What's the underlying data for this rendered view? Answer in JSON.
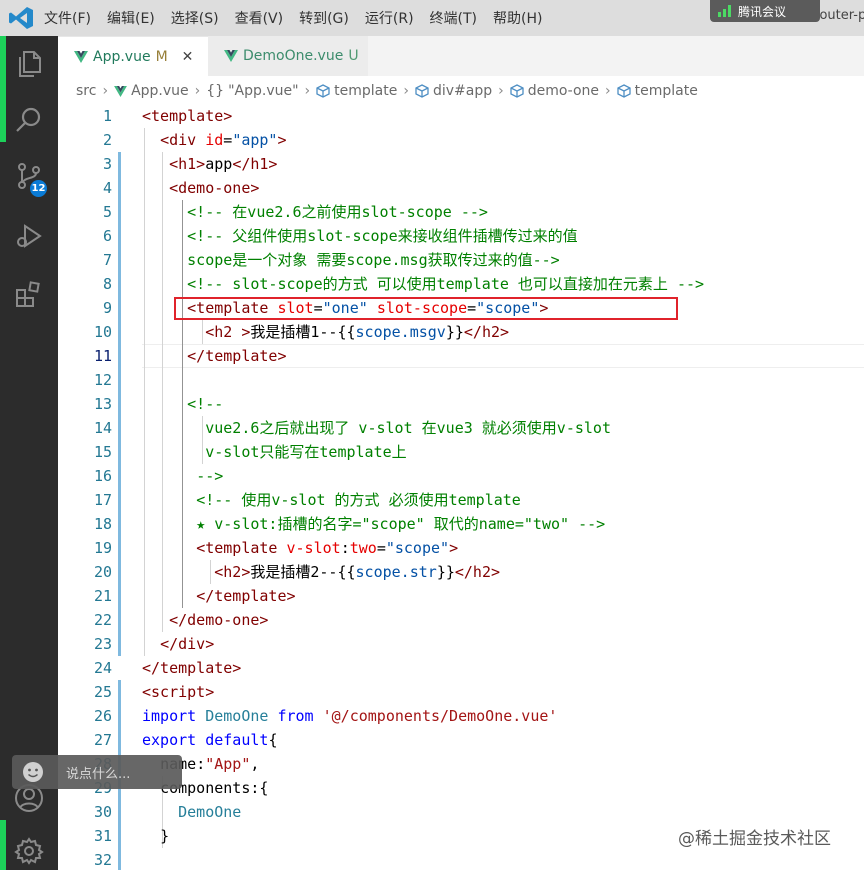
{
  "menu": [
    "文件(F)",
    "编辑(E)",
    "选择(S)",
    "查看(V)",
    "转到(G)",
    "运行(R)",
    "终端(T)",
    "帮助(H)"
  ],
  "window_title": "App.vue - router-p",
  "meeting_label": "腾讯会议",
  "colors": {
    "activity_bar": "#2c2c2c",
    "accent_green": "#1dd15a",
    "highlight_box": "#e0232b",
    "badge": "#0a7bd6"
  },
  "activity_bar": {
    "icons": [
      "explorer-icon",
      "search-icon",
      "source-control-icon",
      "run-debug-icon",
      "extensions-icon",
      "account-icon",
      "settings-gear-icon"
    ],
    "scm_badge": "12"
  },
  "tabs": [
    {
      "label": "App.vue",
      "status": "M",
      "active": true
    },
    {
      "label": "DemoOne.vue",
      "status": "U",
      "active": false
    }
  ],
  "tab_close": "✕",
  "breadcrumb": [
    "src",
    "App.vue",
    "\"App.vue\"",
    "template",
    "div#app",
    "demo-one",
    "template"
  ],
  "editor": {
    "active_line": "11",
    "lines": [
      {
        "n": "1",
        "tokens": [
          [
            "t",
            "<template>"
          ]
        ]
      },
      {
        "n": "2",
        "tokens": [
          [
            "p",
            "  "
          ],
          [
            "t",
            "<div"
          ],
          [
            "p",
            " "
          ],
          [
            "a",
            "id"
          ],
          [
            "p",
            "="
          ],
          [
            "s",
            "\"app\""
          ],
          [
            "t",
            ">"
          ]
        ]
      },
      {
        "n": "3",
        "tokens": [
          [
            "p",
            "   "
          ],
          [
            "t",
            "<h1>"
          ],
          [
            "p",
            "app"
          ],
          [
            "t",
            "</h1>"
          ]
        ]
      },
      {
        "n": "4",
        "tokens": [
          [
            "p",
            "   "
          ],
          [
            "t",
            "<demo-one>"
          ]
        ]
      },
      {
        "n": "5",
        "tokens": [
          [
            "p",
            "     "
          ],
          [
            "c",
            "<!-- 在vue2.6之前使用slot-scope -->"
          ]
        ]
      },
      {
        "n": "6",
        "tokens": [
          [
            "p",
            "     "
          ],
          [
            "c",
            "<!-- 父组件使用slot-scope来接收组件插槽传过来的值"
          ]
        ]
      },
      {
        "n": "7",
        "tokens": [
          [
            "p",
            "     "
          ],
          [
            "c",
            "scope是一个对象 需要scope.msg获取传过来的值-->"
          ]
        ]
      },
      {
        "n": "8",
        "tokens": [
          [
            "p",
            "     "
          ],
          [
            "c",
            "<!-- slot-scope的方式 可以使用template 也可以直接加在元素上 -->"
          ]
        ]
      },
      {
        "n": "9",
        "tokens": [
          [
            "p",
            "     "
          ],
          [
            "t",
            "<template"
          ],
          [
            "p",
            " "
          ],
          [
            "a",
            "slot"
          ],
          [
            "p",
            "="
          ],
          [
            "s",
            "\"one\""
          ],
          [
            "p",
            " "
          ],
          [
            "a",
            "slot-scope"
          ],
          [
            "p",
            "="
          ],
          [
            "s",
            "\"scope\""
          ],
          [
            "t",
            ">"
          ]
        ]
      },
      {
        "n": "10",
        "tokens": [
          [
            "p",
            "       "
          ],
          [
            "t",
            "<h2"
          ],
          [
            "p",
            " "
          ],
          [
            "t",
            ">"
          ],
          [
            "p",
            "我是插槽1--{{"
          ],
          [
            "s",
            "scope.msgv"
          ],
          [
            "p",
            "}}"
          ],
          [
            "t",
            "</h2>"
          ]
        ]
      },
      {
        "n": "11",
        "tokens": [
          [
            "p",
            "     "
          ],
          [
            "t",
            "</template>"
          ]
        ]
      },
      {
        "n": "12",
        "tokens": []
      },
      {
        "n": "13",
        "tokens": [
          [
            "p",
            "     "
          ],
          [
            "c",
            "<!--"
          ]
        ]
      },
      {
        "n": "14",
        "tokens": [
          [
            "p",
            "       "
          ],
          [
            "c",
            "vue2.6之后就出现了 v-slot 在vue3 就必须使用v-slot"
          ]
        ]
      },
      {
        "n": "15",
        "tokens": [
          [
            "p",
            "       "
          ],
          [
            "c",
            "v-slot只能写在template上"
          ]
        ]
      },
      {
        "n": "16",
        "tokens": [
          [
            "p",
            "      "
          ],
          [
            "c",
            "-->"
          ]
        ]
      },
      {
        "n": "17",
        "tokens": [
          [
            "p",
            "      "
          ],
          [
            "c",
            "<!-- 使用v-slot 的方式 必须使用template"
          ]
        ]
      },
      {
        "n": "18",
        "tokens": [
          [
            "p",
            "      "
          ],
          [
            "c",
            "★ v-slot:插槽的名字=\"scope\" 取代的name=\"two\" -->"
          ]
        ]
      },
      {
        "n": "19",
        "tokens": [
          [
            "p",
            "      "
          ],
          [
            "t",
            "<template"
          ],
          [
            "p",
            " "
          ],
          [
            "a",
            "v-slot"
          ],
          [
            "p",
            ":"
          ],
          [
            "a",
            "two"
          ],
          [
            "p",
            "="
          ],
          [
            "s",
            "\"scope\""
          ],
          [
            "t",
            ">"
          ]
        ]
      },
      {
        "n": "20",
        "tokens": [
          [
            "p",
            "        "
          ],
          [
            "t",
            "<h2>"
          ],
          [
            "p",
            "我是插槽2--{{"
          ],
          [
            "s",
            "scope.str"
          ],
          [
            "p",
            "}}"
          ],
          [
            "t",
            "</h2>"
          ]
        ]
      },
      {
        "n": "21",
        "tokens": [
          [
            "p",
            "      "
          ],
          [
            "t",
            "</template>"
          ]
        ]
      },
      {
        "n": "22",
        "tokens": [
          [
            "p",
            "   "
          ],
          [
            "t",
            "</demo-one>"
          ]
        ]
      },
      {
        "n": "23",
        "tokens": [
          [
            "p",
            "  "
          ],
          [
            "t",
            "</div>"
          ]
        ]
      },
      {
        "n": "24",
        "tokens": [
          [
            "t",
            "</template>"
          ]
        ]
      },
      {
        "n": "25",
        "tokens": [
          [
            "t",
            "<script>"
          ]
        ]
      },
      {
        "n": "26",
        "tokens": [
          [
            "k",
            "import"
          ],
          [
            "p",
            " "
          ],
          [
            "m",
            "DemoOne"
          ],
          [
            "p",
            " "
          ],
          [
            "k",
            "from"
          ],
          [
            "p",
            " "
          ],
          [
            "sf",
            "'@/components/DemoOne.vue'"
          ]
        ]
      },
      {
        "n": "27",
        "tokens": [
          [
            "k",
            "export"
          ],
          [
            "p",
            " "
          ],
          [
            "k",
            "default"
          ],
          [
            "p",
            "{"
          ]
        ]
      },
      {
        "n": "28",
        "tokens": [
          [
            "p",
            "  "
          ],
          [
            "p",
            "name"
          ],
          [
            "p",
            ":"
          ],
          [
            "sf",
            "\"App\""
          ],
          [
            "p",
            ","
          ]
        ]
      },
      {
        "n": "29",
        "tokens": [
          [
            "p",
            "  "
          ],
          [
            "p",
            "components"
          ],
          [
            "p",
            ":{"
          ]
        ]
      },
      {
        "n": "30",
        "tokens": [
          [
            "p",
            "    "
          ],
          [
            "m",
            "DemoOne"
          ]
        ]
      },
      {
        "n": "31",
        "tokens": [
          [
            "p",
            "  "
          ],
          [
            "p",
            "}"
          ]
        ]
      },
      {
        "n": "32",
        "tokens": []
      }
    ]
  },
  "chat_placeholder": "说点什么...",
  "watermark": "@稀土掘金技术社区"
}
